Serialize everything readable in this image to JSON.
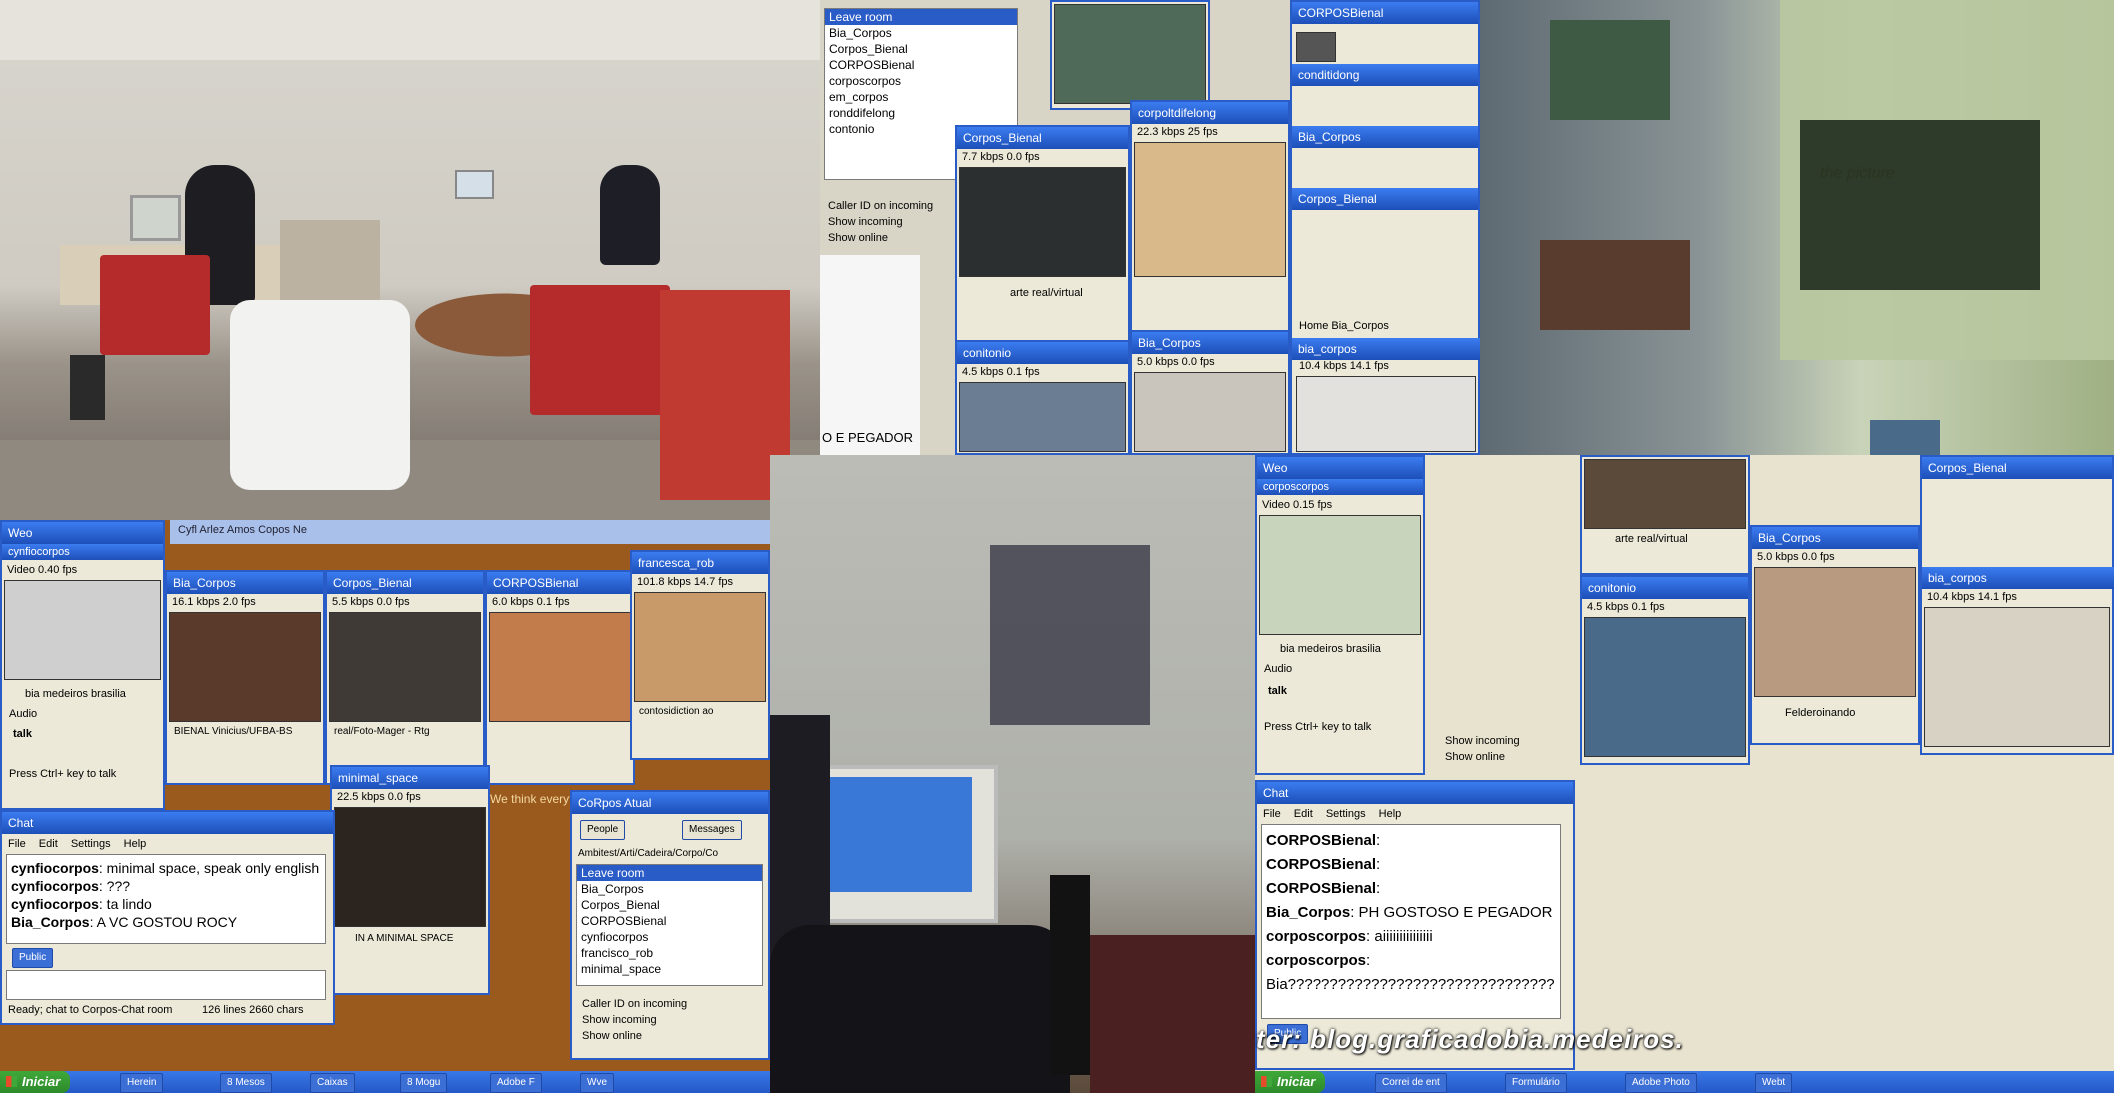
{
  "room_photo": {
    "label": "office interior photo"
  },
  "top_center": {
    "list_items": [
      "Leave room",
      "Bia_Corpos",
      "Corpos_Bienal",
      "CORPOSBienal",
      "corposcorpos",
      "em_corpos",
      "ronddifelong",
      "contonio"
    ],
    "checkboxes": [
      "Caller ID on incoming",
      "Show incoming",
      "Show online"
    ],
    "video_titles": [
      "Corpos_Bienal",
      "corpoltdifelong",
      "conitonio",
      "Bia_Corpos",
      "CORPOSBienal",
      "conditidong",
      "Bia_Corpos",
      "Corpos_Bienal",
      "bia_corpos"
    ],
    "rates": [
      "7.7 kbps  0.0 fps",
      "22.3 kbps  25 fps",
      "4.5 kbps  0.1 fps",
      "5.0 kbps  0.0 fps",
      "10.4 kbps  14.1 fps"
    ],
    "caption_1": "arte real/virtual",
    "caption_2": "Home Bia_Corpos",
    "footer_text": "O E PEGADOR"
  },
  "bottom_left": {
    "title_main": "Weo",
    "title_second": "Cyfl Arlez Amos Copos Ne",
    "side_title": "cynfiocorpos",
    "side_rate": "Video  0.40 fps",
    "side_caption": "bia medeiros brasilia",
    "audio_label": "Audio",
    "talk": "talk",
    "push_hint": "Press Ctrl+ key to talk",
    "video_titles": [
      "Bia_Corpos",
      "Corpos_Bienal",
      "CORPOSBienal",
      "francesca_rob"
    ],
    "rates": [
      "16.1 kbps  2.0 fps",
      "5.5 kbps  0.0 fps",
      "6.0 kbps  0.1 fps",
      "101.8 kbps  14.7 fps"
    ],
    "captions": [
      "BIENAL Vinicius/UFBA-BS",
      "real/Foto-Mager - Rtg",
      "",
      "contosidiction ao"
    ],
    "minimal_title": "minimal_space",
    "minimal_rate": "22.5 kbps  0.0 fps",
    "minimal_caption": "IN A MINIMAL SPACE",
    "orange_text": "We think everything we see on TV, on movies",
    "chat": {
      "title": "Chat",
      "menu": [
        "File",
        "Edit",
        "Settings",
        "Help"
      ],
      "lines": [
        {
          "user": "cynfiocorpos",
          "text": ": minimal space, speak only english"
        },
        {
          "user": "cynfiocorpos",
          "text": ": ???"
        },
        {
          "user": "cynfiocorpos",
          "text": ": ta lindo"
        },
        {
          "user": "Bia_Corpos",
          "text": ": A VC GOSTOU ROCY"
        }
      ],
      "public_btn": "Public",
      "status": "Ready; chat to Corpos-Chat room",
      "status_right": "126 lines  2660 chars"
    },
    "list_window": {
      "title": "CoRpos Atual",
      "people_btn": "People",
      "messages_btn": "Messages",
      "path": "Ambitest/Arti/Cadeira/Corpo/Co",
      "items": [
        "Leave room",
        "Bia_Corpos",
        "Corpos_Bienal",
        "CORPOSBienal",
        "cynfiocorpos",
        "francisco_rob",
        "minimal_space"
      ],
      "checkboxes": [
        "Caller ID on incoming",
        "Show incoming",
        "Show online"
      ]
    },
    "taskbar": {
      "start": "Iniciar",
      "items": [
        "Herein",
        "8 Mesos",
        "Caixas",
        "8 Mogu",
        "Adobe F",
        "Wve"
      ]
    }
  },
  "bottom_right": {
    "left_window": {
      "title": "Weo",
      "side_title": "corposcorpos",
      "side_rate": "Video  0.15 fps",
      "side_caption": "bia medeiros brasilia",
      "audio_label": "Audio",
      "talk": "talk",
      "push_hint": "Press Ctrl+ key to talk",
      "checkboxes": [
        "Show incoming",
        "Show online"
      ]
    },
    "chat": {
      "title": "Chat",
      "menu": [
        "File",
        "Edit",
        "Settings",
        "Help"
      ],
      "lines": [
        {
          "user": "CORPOSBienal",
          "text": ":"
        },
        {
          "user": "CORPOSBienal",
          "text": ":"
        },
        {
          "user": "CORPOSBienal",
          "text": ":"
        },
        {
          "user": "Bia_Corpos",
          "text": ": PH GOSTOSO E PEGADOR"
        },
        {
          "user": "corposcorpos",
          "text": ": aiiiiiiiiiiiiiii"
        },
        {
          "user": "corposcorpos",
          "text": ":"
        },
        {
          "user": "",
          "text": "Bia????????????????????????????????"
        }
      ],
      "public_btn": "Public"
    },
    "video_titles": [
      "Corpos_Bienal",
      "conitonio",
      "Bia_Corpos",
      "bia_corpos"
    ],
    "rates": [
      "4.5 kbps  0.1 fps",
      "5.0 kbps  0.0 fps",
      "10.4 kbps  14.1 fps"
    ],
    "captions": [
      "arte real/virtual",
      "Felderoinando"
    ],
    "taskbar": {
      "start": "Iniciar",
      "items": [
        "Correi de ent",
        "Formulário",
        "Adobe Photo",
        "Webt"
      ]
    }
  },
  "credit": "ter: blog.graficadobia.medeiros."
}
